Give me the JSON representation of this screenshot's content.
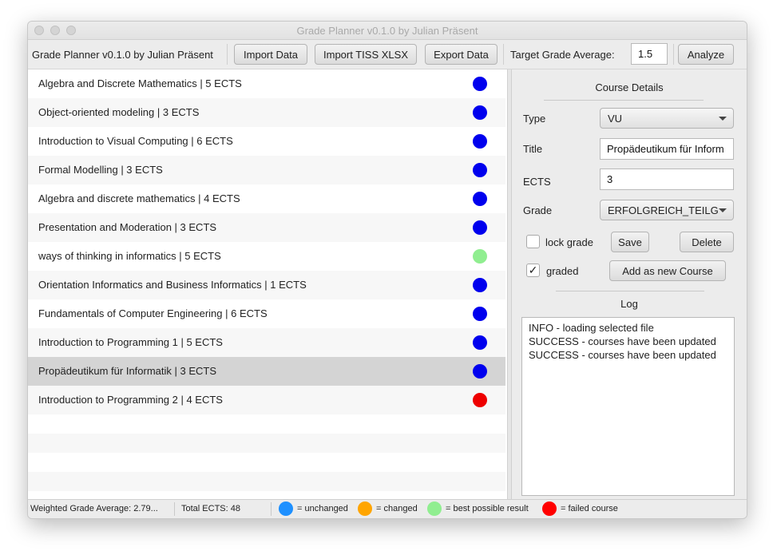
{
  "window": {
    "title": "Grade Planner v0.1.0 by Julian Präsent"
  },
  "toolbar": {
    "app_label": "Grade Planner v0.1.0 by Julian Präsent",
    "import_data": "Import Data",
    "import_tiss": "Import TISS XLSX",
    "export_data": "Export Data",
    "target_label": "Target Grade Average:",
    "target_value": "1.5",
    "analyze": "Analyze"
  },
  "courses": [
    {
      "label": "Algebra and Discrete Mathematics | 5 ECTS",
      "status": "unchanged"
    },
    {
      "label": "Object-oriented modeling | 3 ECTS",
      "status": "unchanged"
    },
    {
      "label": "Introduction to Visual Computing | 6 ECTS",
      "status": "unchanged"
    },
    {
      "label": "Formal Modelling | 3 ECTS",
      "status": "unchanged"
    },
    {
      "label": "Algebra and discrete mathematics | 4 ECTS",
      "status": "unchanged"
    },
    {
      "label": "Presentation and Moderation | 3 ECTS",
      "status": "unchanged"
    },
    {
      "label": "ways of thinking in informatics | 5 ECTS",
      "status": "best"
    },
    {
      "label": "Orientation Informatics and Business Informatics | 1 ECTS",
      "status": "unchanged"
    },
    {
      "label": "Fundamentals of Computer Engineering | 6 ECTS",
      "status": "unchanged"
    },
    {
      "label": "Introduction to Programming 1 | 5 ECTS",
      "status": "unchanged"
    },
    {
      "label": "Propädeutikum für Informatik | 3 ECTS",
      "status": "unchanged",
      "selected": true
    },
    {
      "label": "Introduction to Programming 2 | 4 ECTS",
      "status": "failed"
    }
  ],
  "details": {
    "title": "Course Details",
    "type_label": "Type",
    "type_value": "VU",
    "title_label": "Title",
    "title_value": "Propädeutikum für Inform",
    "ects_label": "ECTS",
    "ects_value": "3",
    "grade_label": "Grade",
    "grade_value": "ERFOLGREICH_TEILG...",
    "lock_grade": "lock grade",
    "lock_checked": false,
    "save": "Save",
    "delete": "Delete",
    "graded": "graded",
    "graded_checked": true,
    "graded_mark": "✓",
    "add_course": "Add as new Course"
  },
  "log": {
    "title": "Log",
    "lines": [
      "INFO - loading selected file",
      "SUCCESS - courses have been updated",
      "SUCCESS - courses have been updated"
    ]
  },
  "status": {
    "weighted_avg": "Weighted Grade Average: 2.79...",
    "total_ects": "Total ECTS: 48",
    "legend": [
      {
        "label": "= unchanged",
        "color": "#1e90ff"
      },
      {
        "label": "= changed",
        "color": "#ffa500"
      },
      {
        "label": "= best possible result",
        "color": "#90ee90"
      },
      {
        "label": "= failed course",
        "color": "#ff0000"
      }
    ]
  },
  "colors": {
    "unchanged": "#0000ee",
    "best": "#90ee90",
    "failed": "#ee0000",
    "selected_row": "#d4d4d4",
    "alt_row": "#f7f7f7"
  }
}
